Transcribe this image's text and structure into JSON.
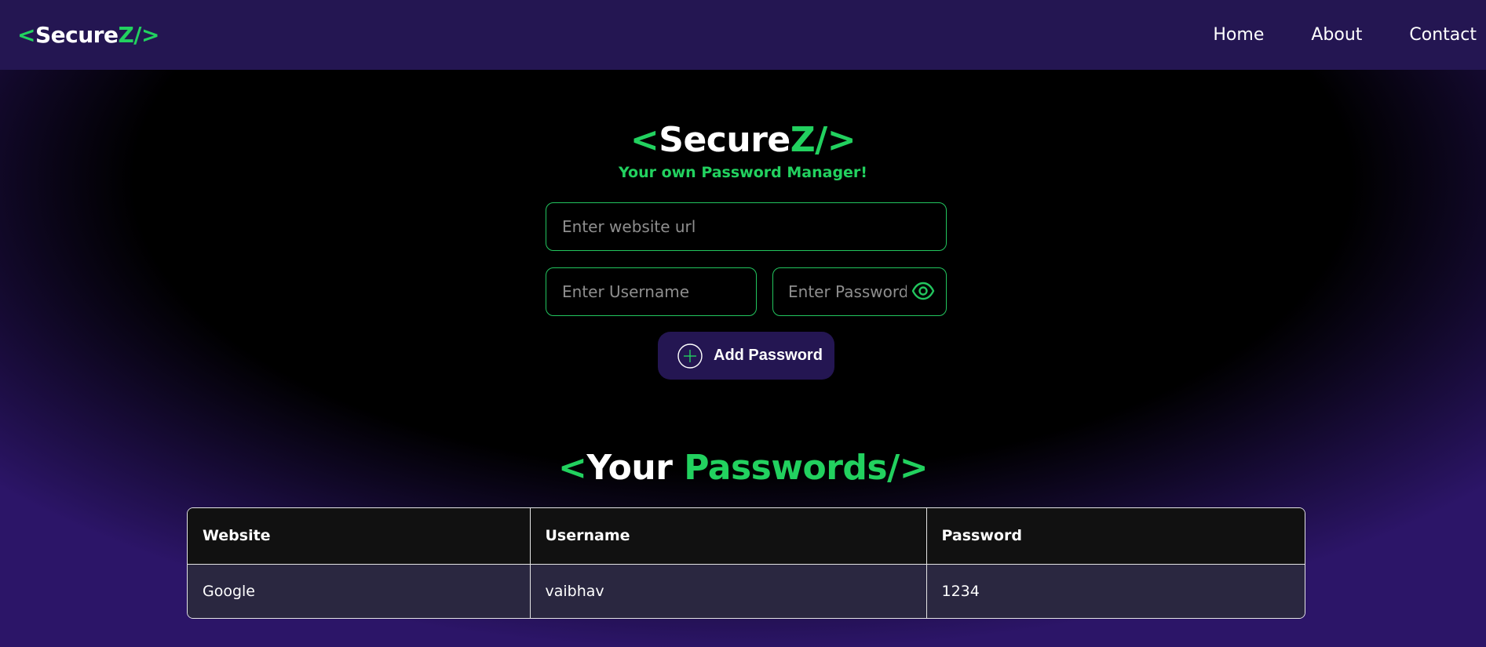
{
  "navbar": {
    "logo": {
      "open": "<",
      "name": "Secure",
      "accent": "Z/",
      "close": ">"
    },
    "links": [
      "Home",
      "About",
      "Contact"
    ]
  },
  "hero": {
    "title": {
      "open": "<",
      "name": "Secure",
      "accent": "Z/",
      "close": ">"
    },
    "subtitle": "Your own Password Manager!"
  },
  "form": {
    "website_placeholder": "Enter website url",
    "username_placeholder": "Enter Username",
    "password_placeholder": "Enter Password",
    "add_button_label": "Add Password",
    "icons": {
      "toggle": "eye-icon",
      "add": "plus-circle-icon"
    }
  },
  "passwords": {
    "title": {
      "open": "<",
      "word1": "Your",
      "word2": "Passwords/",
      "close": ">"
    },
    "columns": [
      "Website",
      "Username",
      "Password"
    ],
    "rows": [
      [
        "Google",
        "vaibhav",
        "1234"
      ]
    ]
  },
  "colors": {
    "accent": "#22d15f",
    "navbar": "#241652",
    "background": "#000000"
  }
}
